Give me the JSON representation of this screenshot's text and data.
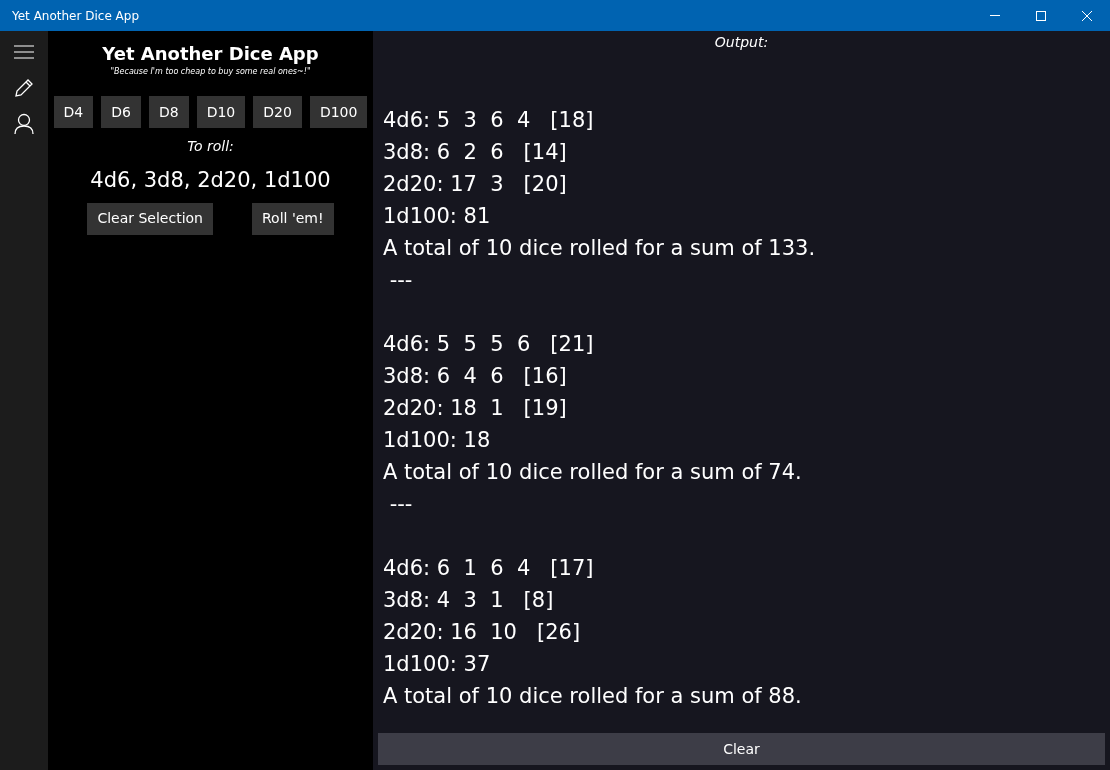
{
  "window": {
    "title": "Yet Another Dice App"
  },
  "nav": [
    {
      "kind": "menu"
    },
    {
      "kind": "pencil"
    },
    {
      "kind": "person"
    }
  ],
  "app": {
    "title": "Yet Another Dice App",
    "tagline": "\"Because I'm too cheap to buy some real ones~!\"",
    "dice": [
      "D4",
      "D6",
      "D8",
      "D10",
      "D20",
      "D100"
    ],
    "to_roll_label": "To roll:",
    "to_roll": "4d6, 3d8, 2d20, 1d100",
    "buttons": [
      "Clear Selection",
      "Roll 'em!"
    ]
  },
  "output": {
    "label": "Output:",
    "blocks": [
      {
        "lines": [
          "4d6: 5  3  6  4   [18]",
          "3d8: 6  2  6   [14]",
          "2d20: 17  3   [20]",
          "1d100: 81",
          "A total of 10 dice rolled for a sum of 133."
        ],
        "separator": " ---"
      },
      {
        "lines": [
          "4d6: 5  5  5  6   [21]",
          "3d8: 6  4  6   [16]",
          "2d20: 18  1   [19]",
          "1d100: 18",
          "A total of 10 dice rolled for a sum of 74."
        ],
        "separator": " ---"
      },
      {
        "lines": [
          "4d6: 6  1  6  4   [17]",
          "3d8: 4  3  1   [8]",
          "2d20: 16  10   [26]",
          "1d100: 37",
          "A total of 10 dice rolled for a sum of 88."
        ]
      }
    ],
    "clear_button": "Clear"
  }
}
